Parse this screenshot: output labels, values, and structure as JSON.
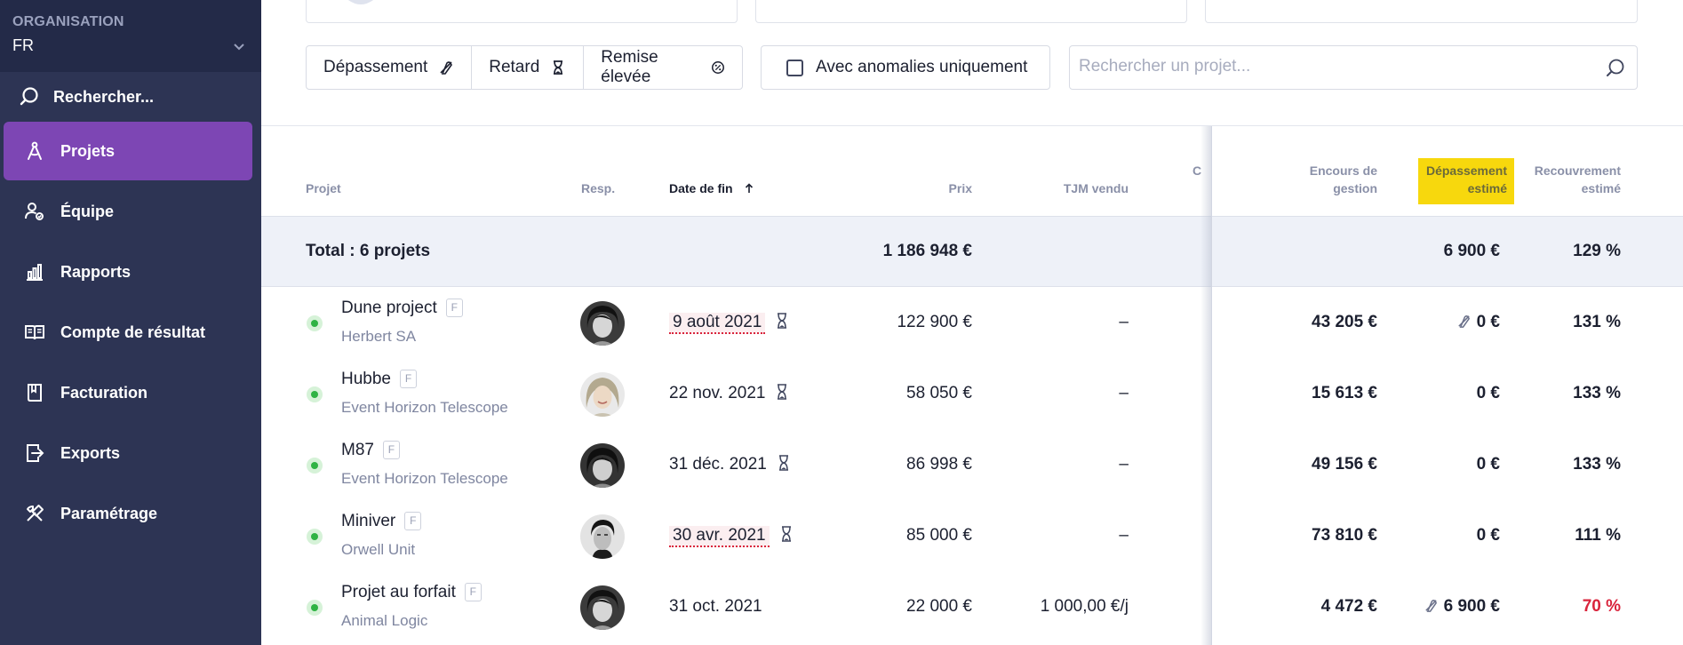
{
  "sidebar": {
    "org_label": "ORGANISATION",
    "org_value": "FR",
    "search_label": "Rechercher...",
    "items": [
      {
        "label": "Projets",
        "icon": "compass-icon",
        "active": true
      },
      {
        "label": "Équipe",
        "icon": "team-icon",
        "active": false
      },
      {
        "label": "Rapports",
        "icon": "bar-chart-icon",
        "active": false
      },
      {
        "label": "Compte de résultat",
        "icon": "book-icon",
        "active": false
      },
      {
        "label": "Facturation",
        "icon": "invoice-icon",
        "active": false
      },
      {
        "label": "Exports",
        "icon": "export-icon",
        "active": false
      },
      {
        "label": "Paramétrage",
        "icon": "tools-icon",
        "active": false
      }
    ]
  },
  "filters": {
    "buttons": [
      {
        "label": "Dépassement",
        "icon": "overrun-icon"
      },
      {
        "label": "Retard",
        "icon": "hourglass-icon"
      },
      {
        "label": "Remise élevée",
        "icon": "discount-icon"
      }
    ],
    "anomalies_label": "Avec anomalies uniquement",
    "search_placeholder": "Rechercher un projet..."
  },
  "table": {
    "headers": {
      "project": "Projet",
      "resp": "Resp.",
      "end_date": "Date de fin",
      "price": "Prix",
      "tjm": "TJM vendu",
      "partial": "C",
      "encours_l1": "Encours de",
      "encours_l2": "gestion",
      "depassement_l1": "Dépassement",
      "depassement_l2": "estimé",
      "recouvrement_l1": "Recouvrement",
      "recouvrement_l2": "estimé"
    },
    "total": {
      "label": "Total : 6 projets",
      "price": "1 186 948 €",
      "depassement": "6 900 €",
      "recouvrement": "129 %"
    },
    "rows": [
      {
        "name": "Dune project",
        "badge": "F",
        "client": "Herbert SA",
        "end_date": "9 août 2021",
        "late": true,
        "hourglass": true,
        "price": "122 900 €",
        "tjm": "–",
        "encours": "43 205 €",
        "overrun_icon": true,
        "depassement": "0 €",
        "recouvrement": "131 %",
        "recouvrement_danger": false
      },
      {
        "name": "Hubbe",
        "badge": "F",
        "client": "Event Horizon Telescope",
        "end_date": "22 nov. 2021",
        "late": false,
        "hourglass": true,
        "price": "58 050 €",
        "tjm": "–",
        "encours": "15 613 €",
        "overrun_icon": false,
        "depassement": "0 €",
        "recouvrement": "133 %",
        "recouvrement_danger": false
      },
      {
        "name": "M87",
        "badge": "F",
        "client": "Event Horizon Telescope",
        "end_date": "31 déc. 2021",
        "late": false,
        "hourglass": true,
        "price": "86 998 €",
        "tjm": "–",
        "encours": "49 156 €",
        "overrun_icon": false,
        "depassement": "0 €",
        "recouvrement": "133 %",
        "recouvrement_danger": false
      },
      {
        "name": "Miniver",
        "badge": "F",
        "client": "Orwell Unit",
        "end_date": "30 avr. 2021",
        "late": true,
        "hourglass": true,
        "price": "85 000 €",
        "tjm": "–",
        "encours": "73 810 €",
        "overrun_icon": false,
        "depassement": "0 €",
        "recouvrement": "111 %",
        "recouvrement_danger": false
      },
      {
        "name": "Projet au forfait",
        "badge": "F",
        "client": "Animal Logic",
        "end_date": "31 oct. 2021",
        "late": false,
        "hourglass": false,
        "price": "22 000 €",
        "tjm": "1 000,00 €/j",
        "encours": "4 472 €",
        "overrun_icon": true,
        "depassement": "6 900 €",
        "recouvrement": "70 %",
        "recouvrement_danger": true
      }
    ]
  },
  "colors": {
    "sidebar_bg": "#2d3454",
    "active_nav": "#7d46b4",
    "highlight": "#f7d80d",
    "danger": "#d9243c",
    "status_ok": "#2fb344"
  }
}
